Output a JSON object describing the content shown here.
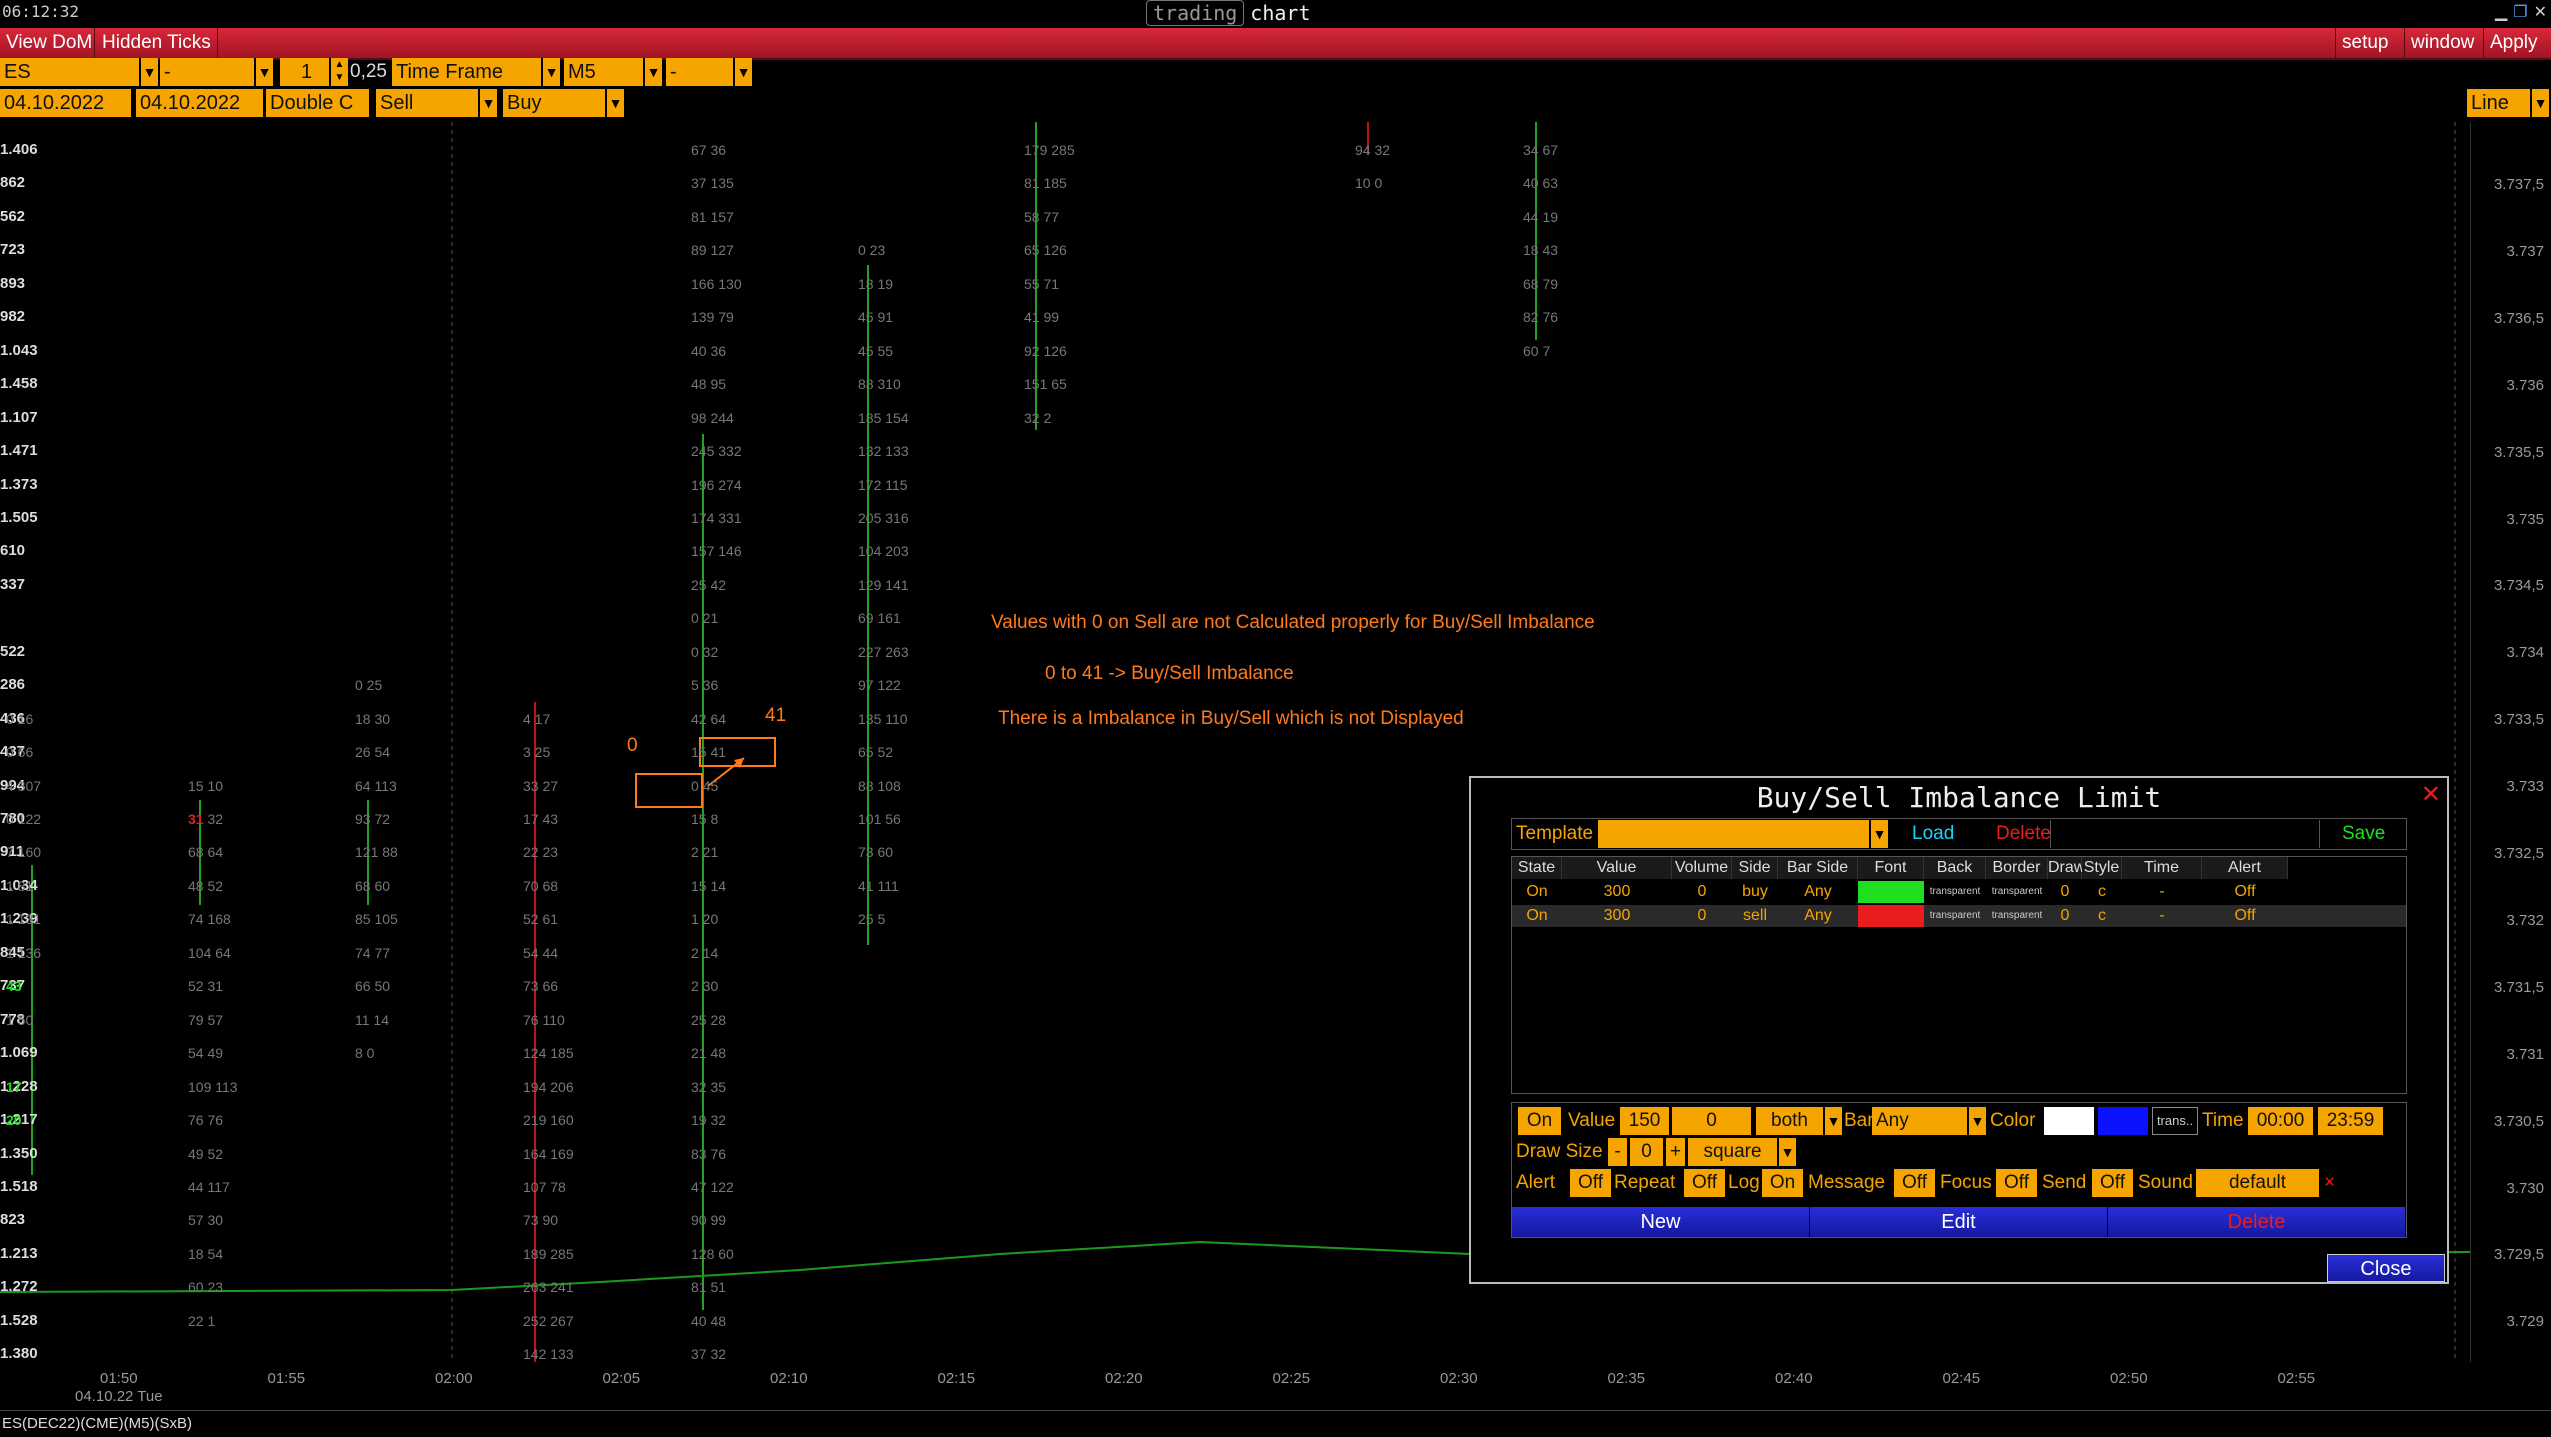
{
  "clock": "06:12:32",
  "brand": {
    "part1": "trading",
    "part2": "chart"
  },
  "menu": {
    "left": [
      "View DoM",
      "Hidden Ticks"
    ],
    "right": [
      "setup",
      "window",
      "Apply"
    ]
  },
  "toolbar1": {
    "symbol": "ES",
    "dash1": "-",
    "qty": "1",
    "tick": "0,25",
    "tf_label": "Time Frame",
    "tf_value": "M5",
    "dash2": "-"
  },
  "toolbar2": {
    "date_from": "04.10.2022",
    "date_to": "04.10.2022",
    "mode": "Double C",
    "sell": "Sell",
    "buy": "Buy",
    "style": "Line"
  },
  "volume_labels": [
    "1.406",
    "862",
    "562",
    "723",
    "893",
    "982",
    "1.043",
    "1.458",
    "1.107",
    "1.471",
    "1.373",
    "1.505",
    "610",
    "337",
    "",
    "522",
    "286",
    "436",
    "437",
    "994",
    "780",
    "911",
    "1.034",
    "1.239",
    "845",
    "737",
    "778",
    "1.069",
    "1.228",
    "1.217",
    "1.350",
    "1.518",
    "823",
    "1.213",
    "1.272",
    "1.528",
    "1.380"
  ],
  "price_axis": [
    "3.737,5",
    "3.737",
    "3.736,5",
    "3.736",
    "3.735,5",
    "3.735",
    "3.734,5",
    "3.734",
    "3.733,5",
    "3.733",
    "3.732,5",
    "3.732",
    "3.731,5",
    "3.731",
    "3.730,5",
    "3.730",
    "3.729,5",
    "3.729"
  ],
  "time_axis": [
    "01:50",
    "01:55",
    "02:00",
    "02:05",
    "02:10",
    "02:15",
    "02:20",
    "02:25",
    "02:30",
    "02:35",
    "02:40",
    "02:45",
    "02:50",
    "02:55"
  ],
  "time_axis_date": "04.10.22 Tue",
  "footprint": {
    "col_0_2": [
      [
        "0 16",
        17
      ],
      [
        "0 66",
        18
      ],
      [
        "4 307",
        19
      ],
      [
        "0 122",
        20
      ],
      [
        "7 160",
        21
      ],
      [
        "1 81",
        22
      ],
      [
        "1 131",
        23
      ],
      [
        "1 136",
        24
      ],
      [
        "",
        25,
        "43"
      ],
      [
        "1 50",
        26
      ],
      [
        "",
        28,
        "17"
      ],
      [
        "",
        29,
        "20"
      ]
    ],
    "col_110": [
      [
        "15 10",
        19
      ],
      [
        "31 32",
        20,
        "r"
      ],
      [
        "68 64",
        21
      ],
      [
        "48 52",
        22
      ],
      [
        "74 168",
        23
      ],
      [
        "104 64",
        24
      ],
      [
        "52 31",
        25
      ],
      [
        "79 57",
        26
      ],
      [
        "54 49",
        27
      ],
      [
        "109 113",
        28
      ],
      [
        "76 76",
        29
      ],
      [
        "49 52",
        30
      ],
      [
        "44 117",
        31
      ],
      [
        "57 30",
        32
      ],
      [
        "18 54",
        33
      ],
      [
        "60 23",
        34
      ],
      [
        "22 1",
        35
      ]
    ],
    "col_215": [
      [
        "0 25",
        16
      ],
      [
        "18 30",
        17
      ],
      [
        "26 54",
        18
      ],
      [
        "64 113",
        19
      ],
      [
        "93 72",
        20
      ],
      [
        "121 88",
        21
      ],
      [
        "68 60",
        22
      ],
      [
        "85 105",
        23
      ],
      [
        "74 77",
        24
      ],
      [
        "66 50",
        25
      ],
      [
        "11 14",
        26
      ],
      [
        "8 0",
        27
      ]
    ],
    "col_320": [
      [
        "4 17",
        17
      ],
      [
        "3 25",
        18
      ],
      [
        "33 27",
        19
      ],
      [
        "17 43",
        20
      ],
      [
        "22 23",
        21
      ],
      [
        "70 68",
        22
      ],
      [
        "52 61",
        23
      ],
      [
        "54 44",
        24
      ],
      [
        "73 66",
        25
      ],
      [
        "76 110",
        26
      ],
      [
        "124 185",
        27
      ],
      [
        "194 206",
        28
      ],
      [
        "219 160",
        29
      ],
      [
        "164 169",
        30
      ],
      [
        "107 78",
        31
      ],
      [
        "73 90",
        32
      ],
      [
        "189 285",
        33
      ],
      [
        "263 241",
        34
      ],
      [
        "252 267",
        35
      ],
      [
        "142 133",
        36
      ]
    ],
    "col_425": [
      [
        "67 36",
        0
      ],
      [
        "37 135",
        1
      ],
      [
        "81 157",
        2
      ],
      [
        "89 127",
        3
      ],
      [
        "166 130",
        4
      ],
      [
        "139 79",
        5
      ],
      [
        "40 36",
        6
      ],
      [
        "48 95",
        7
      ],
      [
        "98 244",
        8
      ],
      [
        "245 332",
        9
      ],
      [
        "196 274",
        10
      ],
      [
        "174 331",
        11
      ],
      [
        "157 146",
        12
      ],
      [
        "25 42",
        13
      ],
      [
        "0 21",
        14
      ],
      [
        "0 32",
        15
      ],
      [
        "5 36",
        16
      ],
      [
        "42 64",
        17
      ],
      [
        "15 41",
        18
      ],
      [
        "0 45",
        19
      ],
      [
        "15 8",
        20
      ],
      [
        "2 21",
        21
      ],
      [
        "15 14",
        22
      ],
      [
        "1 20",
        23
      ],
      [
        "2 14",
        24
      ],
      [
        "2 30",
        25
      ],
      [
        "25 28",
        26
      ],
      [
        "21 48",
        27
      ],
      [
        "32 35",
        28
      ],
      [
        "19 32",
        29
      ],
      [
        "83 76",
        30
      ],
      [
        "47 122",
        31
      ],
      [
        "90 99",
        32
      ],
      [
        "128 60",
        33
      ],
      [
        "81 51",
        34
      ],
      [
        "40 48",
        35
      ],
      [
        "37 32",
        36
      ]
    ],
    "col_530": [
      [
        "0 23",
        3
      ],
      [
        "18 19",
        4
      ],
      [
        "45 91",
        5
      ],
      [
        "45 55",
        6
      ],
      [
        "88 310",
        7
      ],
      [
        "185 154",
        8
      ],
      [
        "132 133",
        9
      ],
      [
        "172 115",
        10
      ],
      [
        "205 316",
        11
      ],
      [
        "104 203",
        12
      ],
      [
        "129 141",
        13
      ],
      [
        "69 161",
        14
      ],
      [
        "227 263",
        15
      ],
      [
        "97 122",
        16
      ],
      [
        "135 110",
        17
      ],
      [
        "65 52",
        18
      ],
      [
        "88 108",
        19
      ],
      [
        "101 56",
        20
      ],
      [
        "73 60",
        21
      ],
      [
        "41 111",
        22
      ],
      [
        "25 5",
        23
      ]
    ],
    "col_636": [
      [
        "179 285",
        0
      ],
      [
        "81 185",
        1
      ],
      [
        "58 77",
        2
      ],
      [
        "65 126",
        3
      ],
      [
        "55 71",
        4
      ],
      [
        "41 99",
        5
      ],
      [
        "92 126",
        6
      ],
      [
        "151 65",
        7
      ],
      [
        "32 2",
        8
      ]
    ],
    "col_838": [
      [
        "94 32",
        0
      ],
      [
        "10 0",
        1
      ]
    ],
    "col_943": [
      [
        "34 67",
        0
      ],
      [
        "40 63",
        1
      ],
      [
        "44 19",
        2
      ],
      [
        "18 43",
        3
      ],
      [
        "68 79",
        4
      ],
      [
        "82 76",
        5
      ],
      [
        "60 7",
        6
      ]
    ]
  },
  "annotations": {
    "line1": "Values with 0 on Sell are not Calculated properly for Buy/Sell Imbalance",
    "line2": "0 to 41 -> Buy/Sell Imbalance",
    "line3": "There is a Imbalance in Buy/Sell which is not Displayed",
    "zero": "0",
    "fortyone": "41"
  },
  "dialog": {
    "title": "Buy/Sell Imbalance Limit",
    "template_label": "Template",
    "load": "Load",
    "delete": "Delete",
    "save": "Save",
    "headers": [
      "State",
      "Value",
      "Volume",
      "Side",
      "Bar Side",
      "Font",
      "Back",
      "Border",
      "Draw",
      "Style",
      "Time",
      "Alert"
    ],
    "rows": [
      {
        "state": "On",
        "value": "300",
        "volume": "0",
        "side": "buy",
        "bar_side": "Any",
        "font_color": "#1fe01f",
        "back": "transparent",
        "border": "transparent",
        "draw": "0",
        "style": "c",
        "time": "-",
        "alert": "Off"
      },
      {
        "state": "On",
        "value": "300",
        "volume": "0",
        "side": "sell",
        "bar_side": "Any",
        "font_color": "#e81d1d",
        "back": "transparent",
        "border": "transparent",
        "draw": "0",
        "style": "c",
        "time": "-",
        "alert": "Off"
      }
    ],
    "editor": {
      "state": "On",
      "value_label": "Value",
      "value": "150",
      "volume": "0",
      "side": "both",
      "bar_label": "Bar",
      "bar": "Any",
      "color_label": "Color",
      "color1": "#ffffff",
      "color2": "#0a12ff",
      "trans": "trans..",
      "time_label": "Time",
      "time_from": "00:00",
      "time_to": "23:59",
      "drawsize_label": "Draw Size",
      "minus": "-",
      "drawsize": "0",
      "plus": "+",
      "shape": "square",
      "alert_label": "Alert",
      "alert": "Off",
      "repeat_label": "Repeat",
      "repeat": "Off",
      "log_label": "Log",
      "log": "On",
      "message_label": "Message",
      "message": "Off",
      "focus_label": "Focus",
      "focus": "Off",
      "send_label": "Send",
      "send": "Off",
      "sound_label": "Sound",
      "sound": "default",
      "sound_clear": "×"
    },
    "buttons": {
      "new": "New",
      "edit": "Edit",
      "delete": "Delete",
      "close": "Close"
    }
  },
  "status": "ES(DEC22)(CME)(M5)(SxB)"
}
